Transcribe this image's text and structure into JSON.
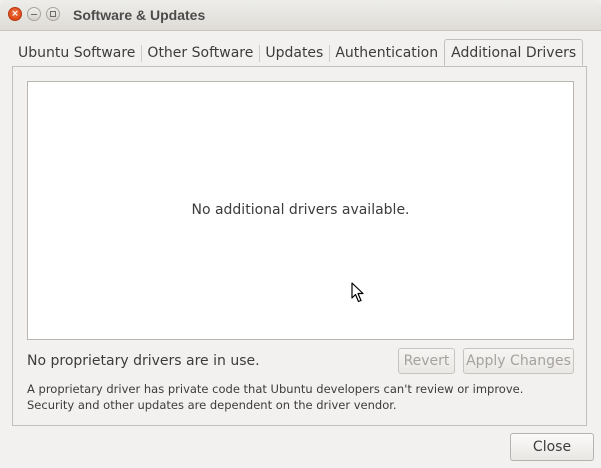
{
  "window": {
    "title": "Software & Updates",
    "controls": [
      "close-icon",
      "minimize-icon",
      "maximize-icon"
    ]
  },
  "tabs": [
    {
      "label": "Ubuntu Software",
      "active": false
    },
    {
      "label": "Other Software",
      "active": false
    },
    {
      "label": "Updates",
      "active": false
    },
    {
      "label": "Authentication",
      "active": false
    },
    {
      "label": "Additional Drivers",
      "active": true
    }
  ],
  "drivers": {
    "empty_message": "No additional drivers available.",
    "status": "No proprietary drivers are in use.",
    "revert_label": "Revert",
    "apply_label": "Apply Changes",
    "note": "A proprietary driver has private code that Ubuntu developers can't review or improve. Security and other updates are dependent on the driver vendor."
  },
  "footer": {
    "close_label": "Close"
  },
  "colors": {
    "window_bg": "#f2f1f0",
    "close_button": "#dd4814"
  }
}
